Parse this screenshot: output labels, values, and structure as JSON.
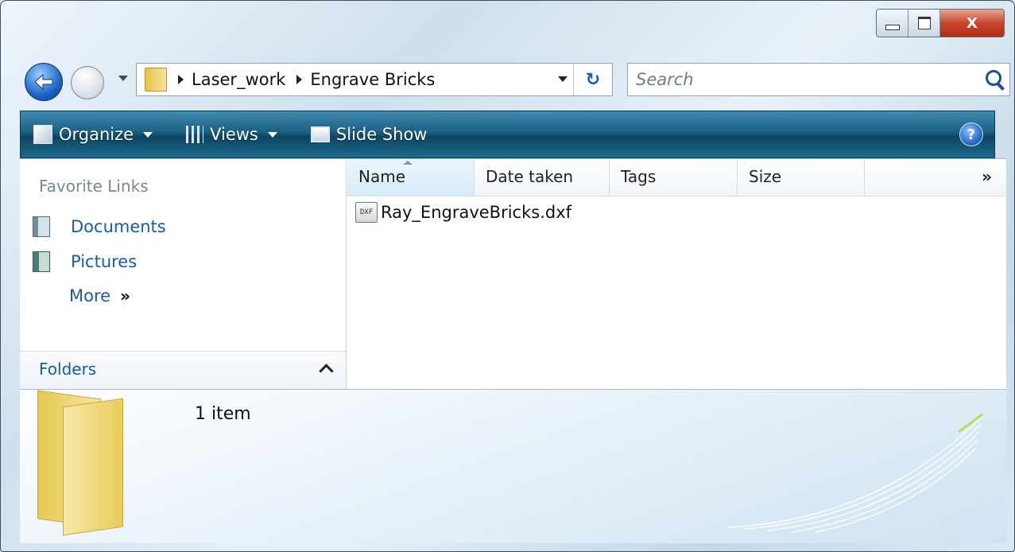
{
  "caption": {
    "minimize_icon": "minimize-icon",
    "maximize_icon": "maximize-icon",
    "close_label": "X"
  },
  "nav": {
    "breadcrumb": [
      "Laser_work",
      "Engrave Bricks"
    ],
    "refresh_glyph": "↻",
    "search_placeholder": "Search"
  },
  "toolbar": {
    "organize_label": "Organize",
    "views_label": "Views",
    "slideshow_label": "Slide Show",
    "help_label": "?"
  },
  "sidebar": {
    "favorites_title": "Favorite Links",
    "items": [
      {
        "label": "Documents",
        "icon": "documents-icon"
      },
      {
        "label": "Pictures",
        "icon": "pictures-icon"
      },
      {
        "label": "More",
        "chevron": "»"
      }
    ],
    "folders_label": "Folders"
  },
  "file_list": {
    "columns": [
      "Name",
      "Date taken",
      "Tags",
      "Size"
    ],
    "more_columns": "»",
    "files": [
      {
        "name": "Ray_EngraveBricks.dxf",
        "icon_text": "DXF"
      }
    ]
  },
  "details": {
    "item_count": "1 item"
  },
  "colors": {
    "toolbar": "#1c5f82",
    "link": "#1c5aa6",
    "close": "#c8472d"
  }
}
